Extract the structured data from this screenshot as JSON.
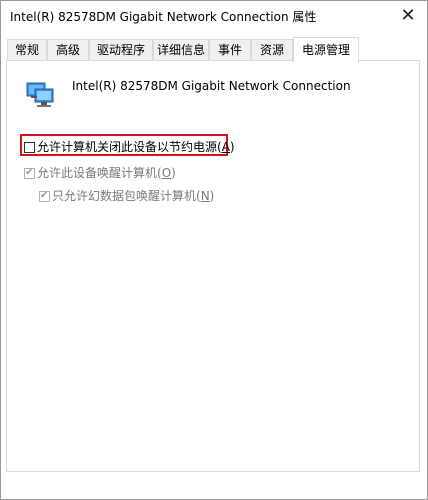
{
  "window": {
    "title": "Intel(R) 82578DM Gigabit Network Connection 属性",
    "close_glyph": "✕"
  },
  "tabs": [
    {
      "label": "常规"
    },
    {
      "label": "高级"
    },
    {
      "label": "驱动程序"
    },
    {
      "label": "详细信息"
    },
    {
      "label": "事件"
    },
    {
      "label": "资源"
    },
    {
      "label": "电源管理"
    }
  ],
  "active_tab": "电源管理",
  "device": {
    "name": "Intel(R) 82578DM Gigabit Network Connection",
    "icon": "network-adapter-icon"
  },
  "options": {
    "allow_power_off": {
      "label": "允许计算机关闭此设备以节约电源(",
      "key": "A",
      "label_end": ")",
      "checked": false,
      "enabled": true
    },
    "allow_wake": {
      "label": "允许此设备唤醒计算机(",
      "key": "O",
      "label_end": ")",
      "checked": true,
      "enabled": false
    },
    "magic_packet_only": {
      "label": "只允许幻数据包唤醒计算机(",
      "key": "N",
      "label_end": ")",
      "checked": true,
      "enabled": false
    }
  },
  "colors": {
    "highlight_border": "#d4151b",
    "disabled_text": "#7a7a7a"
  }
}
